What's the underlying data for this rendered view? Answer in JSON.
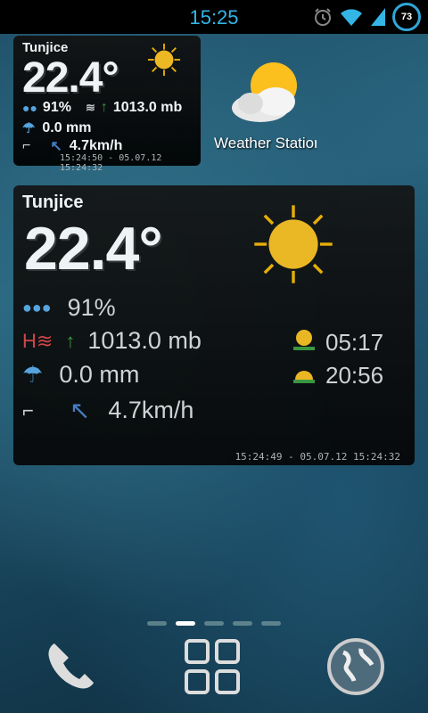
{
  "status": {
    "time": "15:25",
    "battery": "73"
  },
  "small_widget": {
    "city": "Tunjice",
    "temp": "22.4°",
    "humidity": "91%",
    "pressure": "1013.0 mb",
    "rain": "0.0 mm",
    "wind": "4.7km/h",
    "timestamp": "15:24:50 - 05.07.12 15:24:32"
  },
  "app": {
    "label": "Weather Station"
  },
  "large_widget": {
    "city": "Tunjice",
    "temp": "22.4°",
    "humidity": "91%",
    "pressure": "1013.0 mb",
    "rain": "0.0 mm",
    "wind": "4.7km/h",
    "sunrise": "05:17",
    "sunset": "20:56",
    "timestamp": "15:24:49 - 05.07.12 15:24:32"
  },
  "dock": {
    "icons": [
      "phone-icon",
      "apps-grid-icon",
      "browser-globe-icon"
    ]
  },
  "colors": {
    "accent": "#33b5e5",
    "pressure_arrow": "#3c9c3c",
    "wind_arrow": "#4a7fc8"
  }
}
